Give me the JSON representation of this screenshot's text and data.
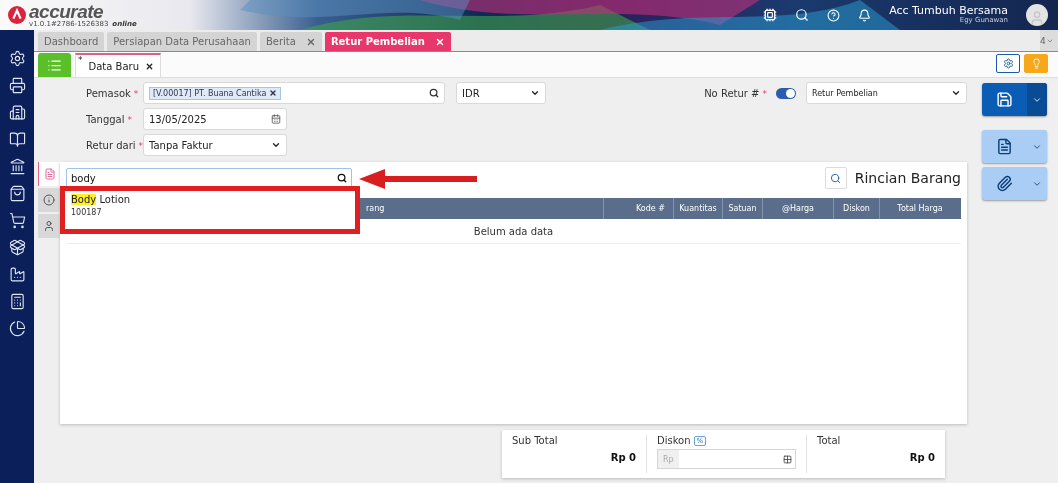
{
  "header": {
    "brand": "accurate",
    "brand_sub": "online",
    "version": "v1.0.1#2786-1526383",
    "company": "Acc Tumbuh Bersama",
    "user": "Egy Gunawan"
  },
  "tabs": [
    {
      "label": "Dashboard",
      "closable": false,
      "selected": false
    },
    {
      "label": "Persiapan Data Perusahaan",
      "closable": false,
      "selected": false
    },
    {
      "label": "Berita",
      "closable": true,
      "selected": false
    },
    {
      "label": "Retur Pembelian",
      "closable": true,
      "selected": true
    }
  ],
  "tab_count": "4",
  "subtabs": [
    {
      "label": "Data Baru",
      "modified_mark": "*",
      "selected": true
    }
  ],
  "required_mark": "*",
  "form": {
    "pemasok": {
      "label": "Pemasok",
      "required": true,
      "value": "[V.00017] PT. Buana Cantika"
    },
    "currency": {
      "value": "IDR"
    },
    "no_retur": {
      "label": "No Retur #",
      "required": true,
      "on": true,
      "value": "Retur Pembelian"
    },
    "tanggal": {
      "label": "Tanggal",
      "required": true,
      "value": "13/05/2025"
    },
    "retur_dari": {
      "label": "Retur dari",
      "required": true,
      "value": "Tanpa Faktur"
    }
  },
  "side_tabs": [
    {
      "kind": "document",
      "selected": true
    },
    {
      "kind": "info",
      "selected": false
    },
    {
      "kind": "person",
      "selected": false
    }
  ],
  "items": {
    "search": {
      "value": "body"
    },
    "title": "Rincian Barang",
    "columns": [
      "rang",
      "Kode #",
      "Kuantitas",
      "Satuan",
      "@Harga",
      "Diskon",
      "Total Harga"
    ],
    "empty_text": "Belum ada data",
    "suggestions": [
      {
        "match": "Body",
        "rest": " Lotion",
        "code": "100187"
      }
    ]
  },
  "totals": {
    "subtotal": {
      "label": "Sub Total",
      "value": "Rp 0"
    },
    "discount": {
      "label": "Diskon",
      "badge": "%",
      "placeholder": "Rp"
    },
    "total": {
      "label": "Total",
      "value": "Rp 0"
    }
  }
}
